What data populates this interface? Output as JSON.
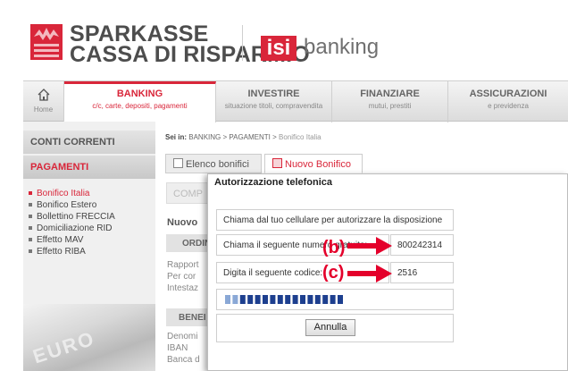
{
  "header": {
    "brand_line1": "SPARKASSE",
    "brand_line2": "CASSA DI RISPARMIO",
    "isi_label": "isi",
    "banking_label": "banking",
    "accent_color": "#d9263a"
  },
  "nav": {
    "home_label": "Home",
    "items": [
      {
        "title": "BANKING",
        "subtitle": "c/c, carte, depositi, pagamenti"
      },
      {
        "title": "INVESTIRE",
        "subtitle": "situazione titoli, compravendita"
      },
      {
        "title": "FINANZIARE",
        "subtitle": "mutui, prestiti"
      },
      {
        "title": "ASSICURAZIONI",
        "subtitle": "e previdenza"
      }
    ]
  },
  "sidebar": {
    "conti_label": "CONTI CORRENTI",
    "pagamenti_label": "PAGAMENTI",
    "items": [
      {
        "label": "Bonifico Italia",
        "active": true
      },
      {
        "label": "Bonifico Estero"
      },
      {
        "label": "Bollettino FRECCIA"
      },
      {
        "label": "Domiciliazione RID"
      },
      {
        "label": "Effetto MAV"
      },
      {
        "label": "Effetto RIBA"
      }
    ],
    "card_text": "EURO"
  },
  "main": {
    "breadcrumb_prefix": "Sei in:",
    "breadcrumb_path": "BANKING > PAGAMENTI >",
    "breadcrumb_current": "Bonifico Italia",
    "tab_elenco": "Elenco bonifici",
    "tab_nuovo": "Nuovo Bonifico",
    "comp_label": "COMP",
    "nuovo_heading": "Nuovo",
    "ordin_label": "ORDIN",
    "lines": [
      "Rapport",
      "Per cor",
      "Intestaz"
    ],
    "benef_label": "BENEI",
    "benef_lines": [
      "Denomi",
      "IBAN",
      "Banca d"
    ]
  },
  "modal": {
    "title": "Autorizzazione telefonica",
    "instruction": "Chiama dal tuo cellulare per autorizzare la disposizione",
    "numero_label": "Chiama il seguente numero gratuito:",
    "numero_value": "800242314",
    "codice_label": "Digita il seguente codice:",
    "codice_value": "2516",
    "progress_segments": 16,
    "annulla_label": "Annulla"
  },
  "annotations": {
    "b_label": "(b)",
    "c_label": "(c)",
    "color": "#e4002b"
  }
}
